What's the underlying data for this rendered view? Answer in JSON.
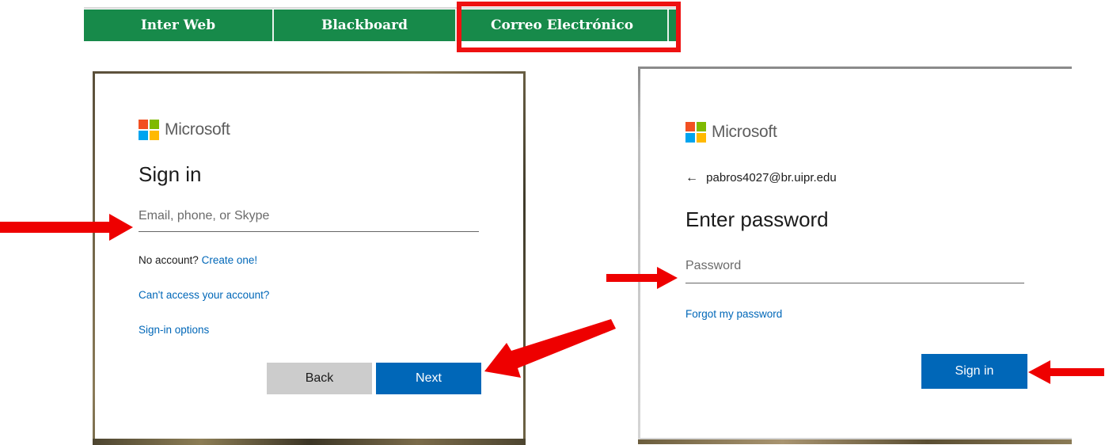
{
  "navbar": {
    "items": [
      "Inter Web",
      "Blackboard",
      "Correo Electrónico",
      ""
    ]
  },
  "left_panel": {
    "logo_text": "Microsoft",
    "title": "Sign in",
    "email_placeholder": "Email, phone, or Skype",
    "no_account_text": "No account?",
    "create_link": "Create one!",
    "cant_access_link": "Can't access your account?",
    "signin_options_link": "Sign-in options",
    "back_label": "Back",
    "next_label": "Next"
  },
  "right_panel": {
    "logo_text": "Microsoft",
    "email": "pabros4027@br.uipr.edu",
    "back_icon": "←",
    "title": "Enter password",
    "password_placeholder": "Password",
    "forgot_link": "Forgot my password",
    "signin_label": "Sign in"
  },
  "colors": {
    "nav_green": "#178a4a",
    "highlight_red": "#ee1111",
    "ms_blue": "#0067b8",
    "arrow_red": "#ee0000"
  },
  "icons": [
    "microsoft-logo-icon",
    "back-arrow-icon",
    "red-pointer-arrow-icon"
  ]
}
